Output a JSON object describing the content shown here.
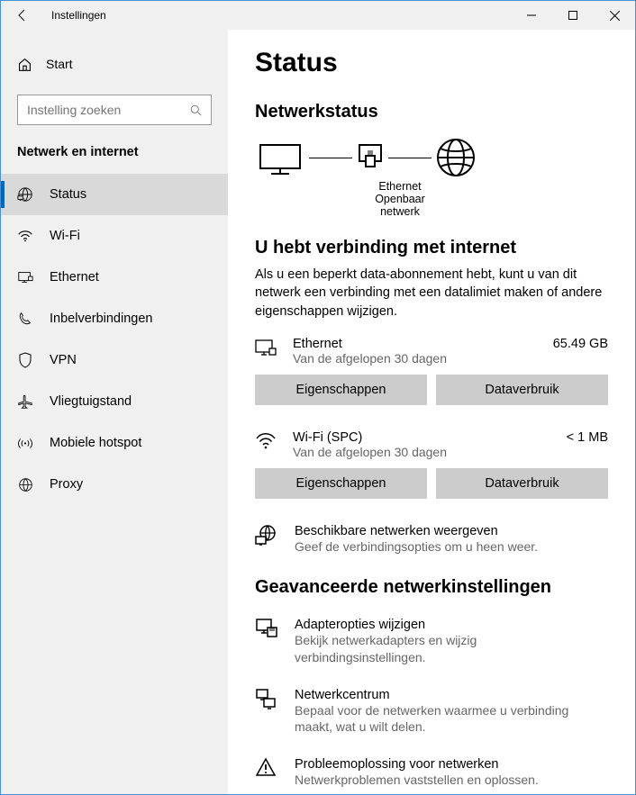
{
  "titlebar": {
    "title": "Instellingen"
  },
  "sidebar": {
    "home_label": "Start",
    "search_placeholder": "Instelling zoeken",
    "section_title": "Netwerk en internet",
    "items": [
      {
        "label": "Status"
      },
      {
        "label": "Wi-Fi"
      },
      {
        "label": "Ethernet"
      },
      {
        "label": "Inbelverbindingen"
      },
      {
        "label": "VPN"
      },
      {
        "label": "Vliegtuigstand"
      },
      {
        "label": "Mobiele hotspot"
      },
      {
        "label": "Proxy"
      }
    ]
  },
  "main": {
    "page_title": "Status",
    "netstatus_title": "Netwerkstatus",
    "diagram": {
      "mid_label1": "Ethernet",
      "mid_label2": "Openbaar netwerk"
    },
    "connected_heading": "U hebt verbinding met internet",
    "connected_desc": "Als u een beperkt data-abonnement hebt, kunt u van dit netwerk een verbinding met een datalimiet maken of andere eigenschappen wijzigen.",
    "connections": [
      {
        "name": "Ethernet",
        "sub": "Van de afgelopen 30 dagen",
        "usage": "65.49 GB",
        "btn_props": "Eigenschappen",
        "btn_usage": "Dataverbruik"
      },
      {
        "name": "Wi-Fi (SPC)",
        "sub": "Van de afgelopen 30 dagen",
        "usage": "< 1 MB",
        "btn_props": "Eigenschappen",
        "btn_usage": "Dataverbruik"
      }
    ],
    "show_networks": {
      "name": "Beschikbare netwerken weergeven",
      "sub": "Geef de verbindingsopties om u heen weer."
    },
    "advanced_title": "Geavanceerde netwerkinstellingen",
    "adv_options": [
      {
        "name": "Adapteropties wijzigen",
        "sub": "Bekijk netwerkadapters en wijzig verbindingsinstellingen."
      },
      {
        "name": "Netwerkcentrum",
        "sub": "Bepaal voor de netwerken waarmee u verbinding maakt, wat u wilt delen."
      },
      {
        "name": "Probleemoplossing voor netwerken",
        "sub": "Netwerkproblemen vaststellen en oplossen."
      }
    ]
  }
}
